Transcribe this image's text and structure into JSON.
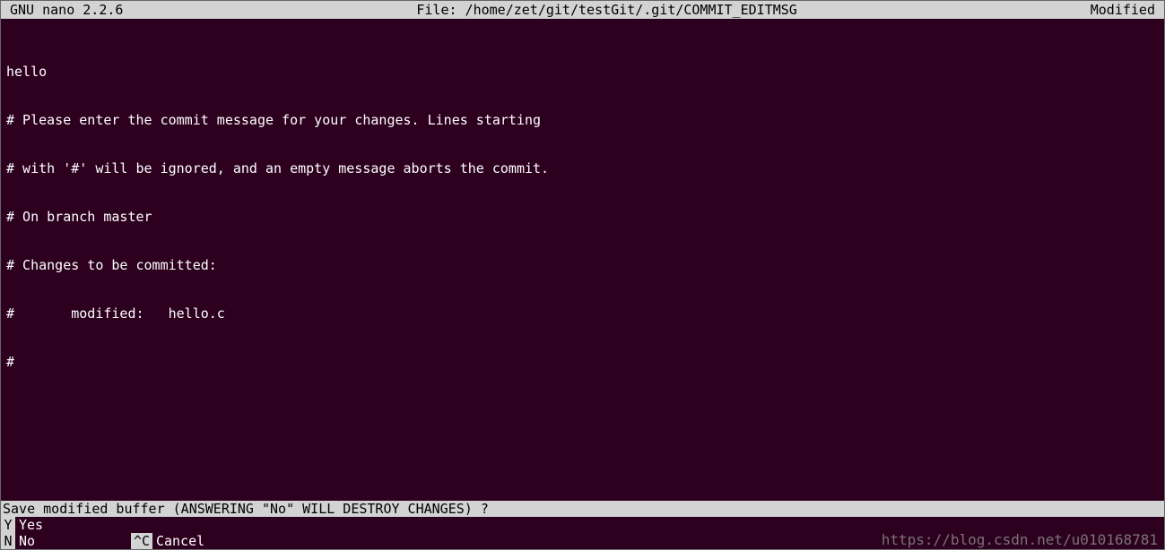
{
  "titlebar": {
    "left": "GNU nano 2.2.6",
    "center": "File: /home/zet/git/testGit/.git/COMMIT_EDITMSG",
    "right": "Modified"
  },
  "editor": {
    "lines": [
      "hello",
      "# Please enter the commit message for your changes. Lines starting",
      "# with '#' will be ignored, and an empty message aborts the commit.",
      "# On branch master",
      "# Changes to be committed:",
      "#       modified:   hello.c",
      "#"
    ]
  },
  "prompt": {
    "text": "Save modified buffer (ANSWERING \"No\" WILL DESTROY CHANGES) ?"
  },
  "shortcuts": {
    "row1": [
      {
        "key": " Y",
        "label": "Yes"
      }
    ],
    "row2": [
      {
        "key": " N",
        "label": "No"
      },
      {
        "key": "^C",
        "label": "Cancel"
      }
    ]
  },
  "watermark": "https://blog.csdn.net/u010168781"
}
